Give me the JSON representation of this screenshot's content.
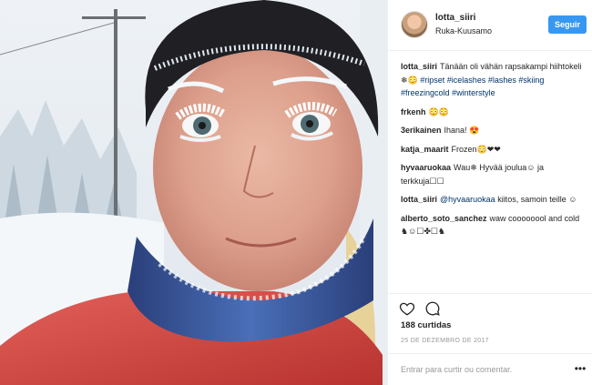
{
  "post": {
    "header": {
      "username": "lotta_siiri",
      "location": "Ruka-Kuusamo",
      "follow_label": "Seguir"
    },
    "caption": {
      "author": "lotta_siiri",
      "text_prefix": "Tänään oli vähän rapsakampi hiihtokeli ❄😳",
      "hashtags": [
        "#ripset",
        "#icelashes",
        "#lashes",
        "#skiing",
        "#freezingcold",
        "#winterstyle"
      ]
    },
    "comments": [
      {
        "author": "frkenh",
        "text": "😳😳"
      },
      {
        "author": "3erikainen",
        "text": "Ihana! 😍"
      },
      {
        "author": "katja_maarit",
        "text": "Frozen😳❤❤"
      },
      {
        "author": "hyvaaruokaa",
        "text": "Wau❄ Hyvää joulua☺ ja terkkuja☐☐"
      },
      {
        "author": "lotta_siiri",
        "mention": "@hyvaaruokaa",
        "text": " kiitos, samoin teille ☺"
      },
      {
        "author": "alberto_soto_sanchez",
        "text": "waw coooooool and cold ♞☺☐✤☐♞"
      }
    ],
    "likes_text": "188 curtidas",
    "date_text": "25 DE DEZEMBRO DE 2017",
    "add_comment": {
      "enter_label": "Entrar",
      "prompt": "para curtir ou comentar."
    },
    "more_label": "•••",
    "icons": {
      "like": "heart-icon",
      "comment": "speech-bubble-icon",
      "more": "ellipsis-icon"
    },
    "colors": {
      "accent": "#3897f0",
      "hashtag": "#003569",
      "muted": "#999999",
      "text": "#262626"
    }
  }
}
